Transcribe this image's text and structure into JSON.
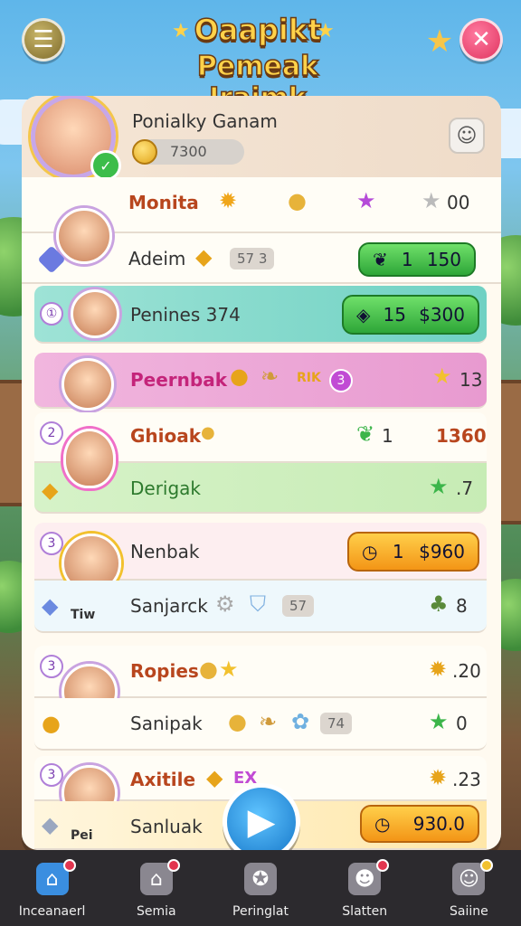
{
  "header": {
    "title_line1": "Oaapikt",
    "title_line2": "Pemeak Iraimk"
  },
  "profile": {
    "name": "Ponialky Ganam",
    "coins": "7300"
  },
  "rows": [
    {
      "label": "Monita",
      "value": "00"
    },
    {
      "label": "Adeim",
      "chip": "57 3",
      "btn_left": "1",
      "btn_right": "150"
    },
    {
      "label": "Penines 374",
      "btn_left": "15",
      "btn_right": "$300"
    },
    {
      "label": "Peernbak",
      "value": "13"
    },
    {
      "label": "Ghioak",
      "mid": "1",
      "value": "1360"
    },
    {
      "label": "Derigak",
      "value": ".7"
    },
    {
      "label": "Nenbak",
      "btn_left": "1",
      "btn_right": "$960"
    },
    {
      "label": "Sanjarck",
      "chip": "57",
      "value": "8"
    },
    {
      "label": "Ropies",
      "value": ".20"
    },
    {
      "label": "Sanipak",
      "chip": "74",
      "value": "0"
    },
    {
      "label": "Axitile",
      "value": ".23"
    },
    {
      "label": "Sanluak",
      "btn": "930.0"
    }
  ],
  "badges": {
    "rank_2": "2",
    "rank_3": "3",
    "rank_4": "3",
    "rank_5": "3",
    "tag_tiw": "Tiw",
    "tag_pei": "Pei",
    "tag_ex": "EX",
    "tag_rik": "RIK"
  },
  "nav": [
    {
      "label": "Inceanaerl"
    },
    {
      "label": "Semia"
    },
    {
      "label": "Peringlat"
    },
    {
      "label": "Slatten"
    },
    {
      "label": "Saiine"
    }
  ],
  "colors": {
    "accent_green": "#2ea638",
    "accent_orange": "#f39516",
    "accent_purple": "#c4247a",
    "nav_bg": "#2c2a2e"
  }
}
